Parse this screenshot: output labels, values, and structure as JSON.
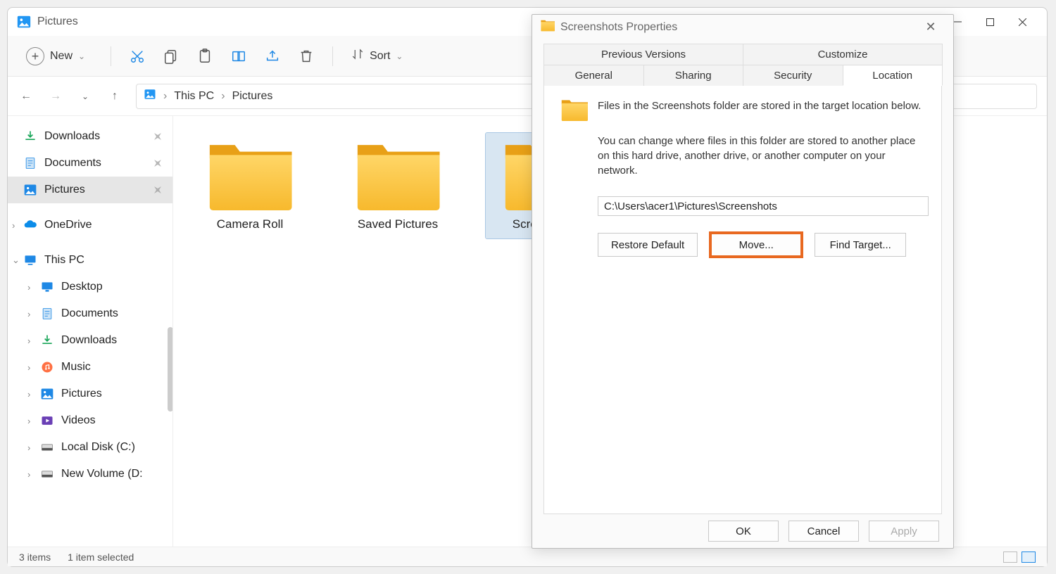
{
  "explorer": {
    "title": "Pictures",
    "toolbar": {
      "new": "New",
      "sort": "Sort"
    },
    "breadcrumb": {
      "root": "This PC",
      "current": "Pictures"
    },
    "sidebar": [
      {
        "label": "Downloads",
        "icon": "download",
        "pinned": true
      },
      {
        "label": "Documents",
        "icon": "document",
        "pinned": true
      },
      {
        "label": "Pictures",
        "icon": "pictures",
        "pinned": true,
        "active": true
      },
      {
        "label": "OneDrive",
        "icon": "onedrive",
        "expander": ">"
      },
      {
        "label": "This PC",
        "icon": "thispc",
        "expander": "v"
      },
      {
        "label": "Desktop",
        "icon": "desktop",
        "child": true,
        "expander": ">"
      },
      {
        "label": "Documents",
        "icon": "document",
        "child": true,
        "expander": ">"
      },
      {
        "label": "Downloads",
        "icon": "download",
        "child": true,
        "expander": ">"
      },
      {
        "label": "Music",
        "icon": "music",
        "child": true,
        "expander": ">"
      },
      {
        "label": "Pictures",
        "icon": "pictures",
        "child": true,
        "expander": ">"
      },
      {
        "label": "Videos",
        "icon": "videos",
        "child": true,
        "expander": ">"
      },
      {
        "label": "Local Disk (C:)",
        "icon": "disk",
        "child": true,
        "expander": ">"
      },
      {
        "label": "New Volume (D:",
        "icon": "disk",
        "child": true,
        "expander": ">"
      }
    ],
    "folders": [
      {
        "label": "Camera Roll"
      },
      {
        "label": "Saved Pictures"
      },
      {
        "label": "Screenshots",
        "selected": true
      }
    ],
    "status": {
      "count": "3 items",
      "selected": "1 item selected"
    }
  },
  "dialog": {
    "title": "Screenshots Properties",
    "tabs_row1": [
      "Previous Versions",
      "Customize"
    ],
    "tabs_row2": [
      "General",
      "Sharing",
      "Security",
      "Location"
    ],
    "active_tab": "Location",
    "desc1": "Files in the Screenshots folder are stored in the target location below.",
    "desc2": "You can change where files in this folder are stored to another place on this hard drive, another drive, or another computer on your network.",
    "path": "C:\\Users\\acer1\\Pictures\\Screenshots",
    "btn_restore": "Restore Default",
    "btn_move": "Move...",
    "btn_find": "Find Target...",
    "footer": {
      "ok": "OK",
      "cancel": "Cancel",
      "apply": "Apply"
    }
  }
}
